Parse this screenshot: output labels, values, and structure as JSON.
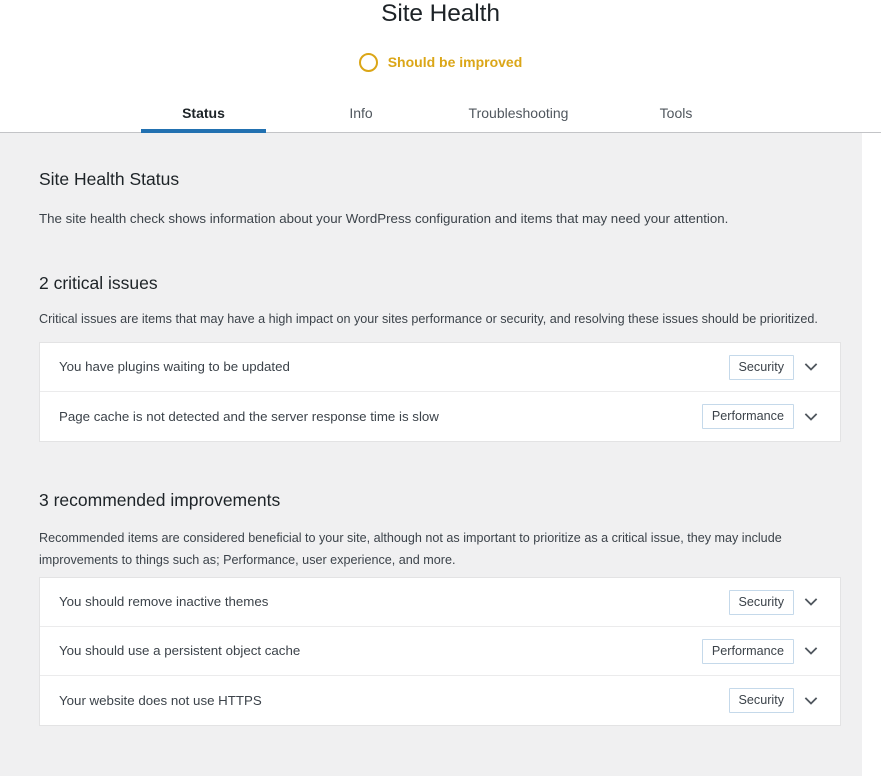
{
  "header": {
    "title": "Site Health",
    "status_icon": "circle-outline-icon",
    "status_label": "Should be improved",
    "status_color": "#dba617",
    "accent_color": "#2271b1"
  },
  "tabs": [
    {
      "label": "Status",
      "active": true
    },
    {
      "label": "Info",
      "active": false
    },
    {
      "label": "Troubleshooting",
      "active": false
    },
    {
      "label": "Tools",
      "active": false
    }
  ],
  "main": {
    "section_title": "Site Health Status",
    "intro": "The site health check shows information about your WordPress configuration and items that may need your attention.",
    "critical": {
      "heading": "2 critical issues",
      "description": "Critical issues are items that may have a high impact on your sites performance or security, and resolving these issues should be prioritized.",
      "issues": [
        {
          "title": "You have plugins waiting to be updated",
          "badge": "Security",
          "toggle_icon": "chevron-down-icon"
        },
        {
          "title": "Page cache is not detected and the server response time is slow",
          "badge": "Performance",
          "toggle_icon": "chevron-down-icon"
        }
      ]
    },
    "recommended": {
      "heading": "3 recommended improvements",
      "description": "Recommended items are considered beneficial to your site, although not as important to prioritize as a critical issue, they may include improvements to things such as; Performance, user experience, and more.",
      "issues": [
        {
          "title": "You should remove inactive themes",
          "badge": "Security",
          "toggle_icon": "chevron-down-icon"
        },
        {
          "title": "You should use a persistent object cache",
          "badge": "Performance",
          "toggle_icon": "chevron-down-icon"
        },
        {
          "title": "Your website does not use HTTPS",
          "badge": "Security",
          "toggle_icon": "chevron-down-icon"
        }
      ]
    }
  }
}
